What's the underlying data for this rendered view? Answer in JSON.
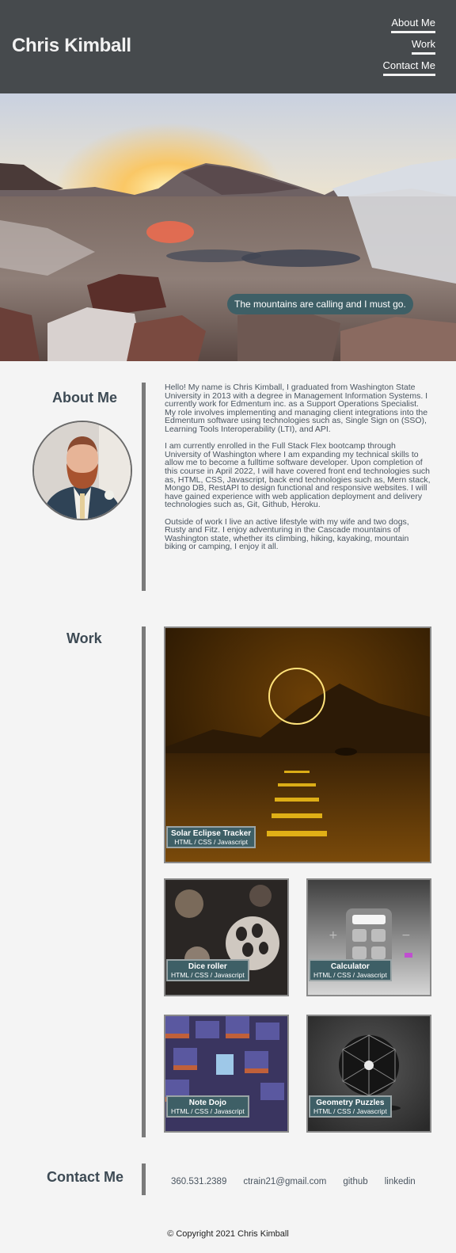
{
  "header": {
    "title": "Chris Kimball",
    "nav": [
      "About Me",
      "Work",
      "Contact Me"
    ]
  },
  "hero": {
    "caption": "The mountains are calling and I must go."
  },
  "about": {
    "heading": "About Me",
    "paragraphs": [
      "Hello! My name is Chris Kimball, I graduated from Washington State University in 2013 with a degree in Management Information Systems. I currently work for Edmentum inc. as a Support Operations Specialist. My role involves implementing and managing client integrations into the Edmentum software using technologies such as, Single Sign on (SSO), Learning Tools Interoperability (LTI), and API.",
      "I am currently enrolled in the Full Stack Flex bootcamp through University of Washington where I am expanding my technical skills to allow me to become a fulltime software developer. Upon completion of this course in April 2022, I will have covered front end technologies such as, HTML, CSS, Javascript, back end technologies such as, Mern stack, Mongo DB, RestAPI to design functional and responsive websites. I will have gained experience with web application deployment and delivery technologies such as, Git, Github, Heroku.",
      "Outside of work I live an active lifestyle with my wife and two dogs, Rusty and Fitz. I enjoy adventuring in the Cascade mountains of Washington state, whether its climbing, hiking, kayaking, mountain biking or camping, I enjoy it all."
    ]
  },
  "work": {
    "heading": "Work",
    "projects": [
      {
        "title": "Solar Eclipse Tracker",
        "tech": "HTML / CSS / Javascript"
      },
      {
        "title": "Dice roller",
        "tech": "HTML / CSS / Javascript"
      },
      {
        "title": "Calculator",
        "tech": "HTML / CSS / Javascript"
      },
      {
        "title": "Note Dojo",
        "tech": "HTML / CSS / Javascript"
      },
      {
        "title": "Geometry Puzzles",
        "tech": "HTML / CSS / Javascript"
      }
    ]
  },
  "contact": {
    "heading": "Contact Me",
    "links": [
      "360.531.2389",
      "ctrain21@gmail.com",
      "github",
      "linkedin"
    ]
  },
  "footer": {
    "copyright": "© Copyright 2021 Chris Kimball"
  }
}
